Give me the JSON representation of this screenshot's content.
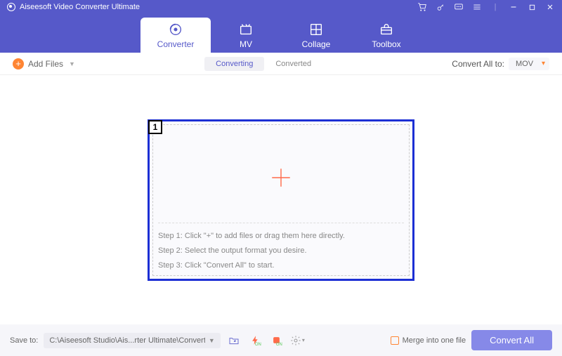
{
  "title": "Aiseesoft Video Converter Ultimate",
  "tabs": [
    {
      "label": "Converter"
    },
    {
      "label": "MV"
    },
    {
      "label": "Collage"
    },
    {
      "label": "Toolbox"
    }
  ],
  "toolbar": {
    "add_files": "Add Files",
    "converting": "Converting",
    "converted": "Converted",
    "convert_all_to": "Convert All to:",
    "format": "MOV"
  },
  "dropzone": {
    "num": "1",
    "step1": "Step 1: Click \"+\" to add files or drag them here directly.",
    "step2": "Step 2: Select the output format you desire.",
    "step3": "Step 3: Click \"Convert All\" to start."
  },
  "footer": {
    "save_to": "Save to:",
    "path": "C:\\Aiseesoft Studio\\Ais...rter Ultimate\\Converted",
    "merge": "Merge into one file",
    "convert_all": "Convert All"
  }
}
